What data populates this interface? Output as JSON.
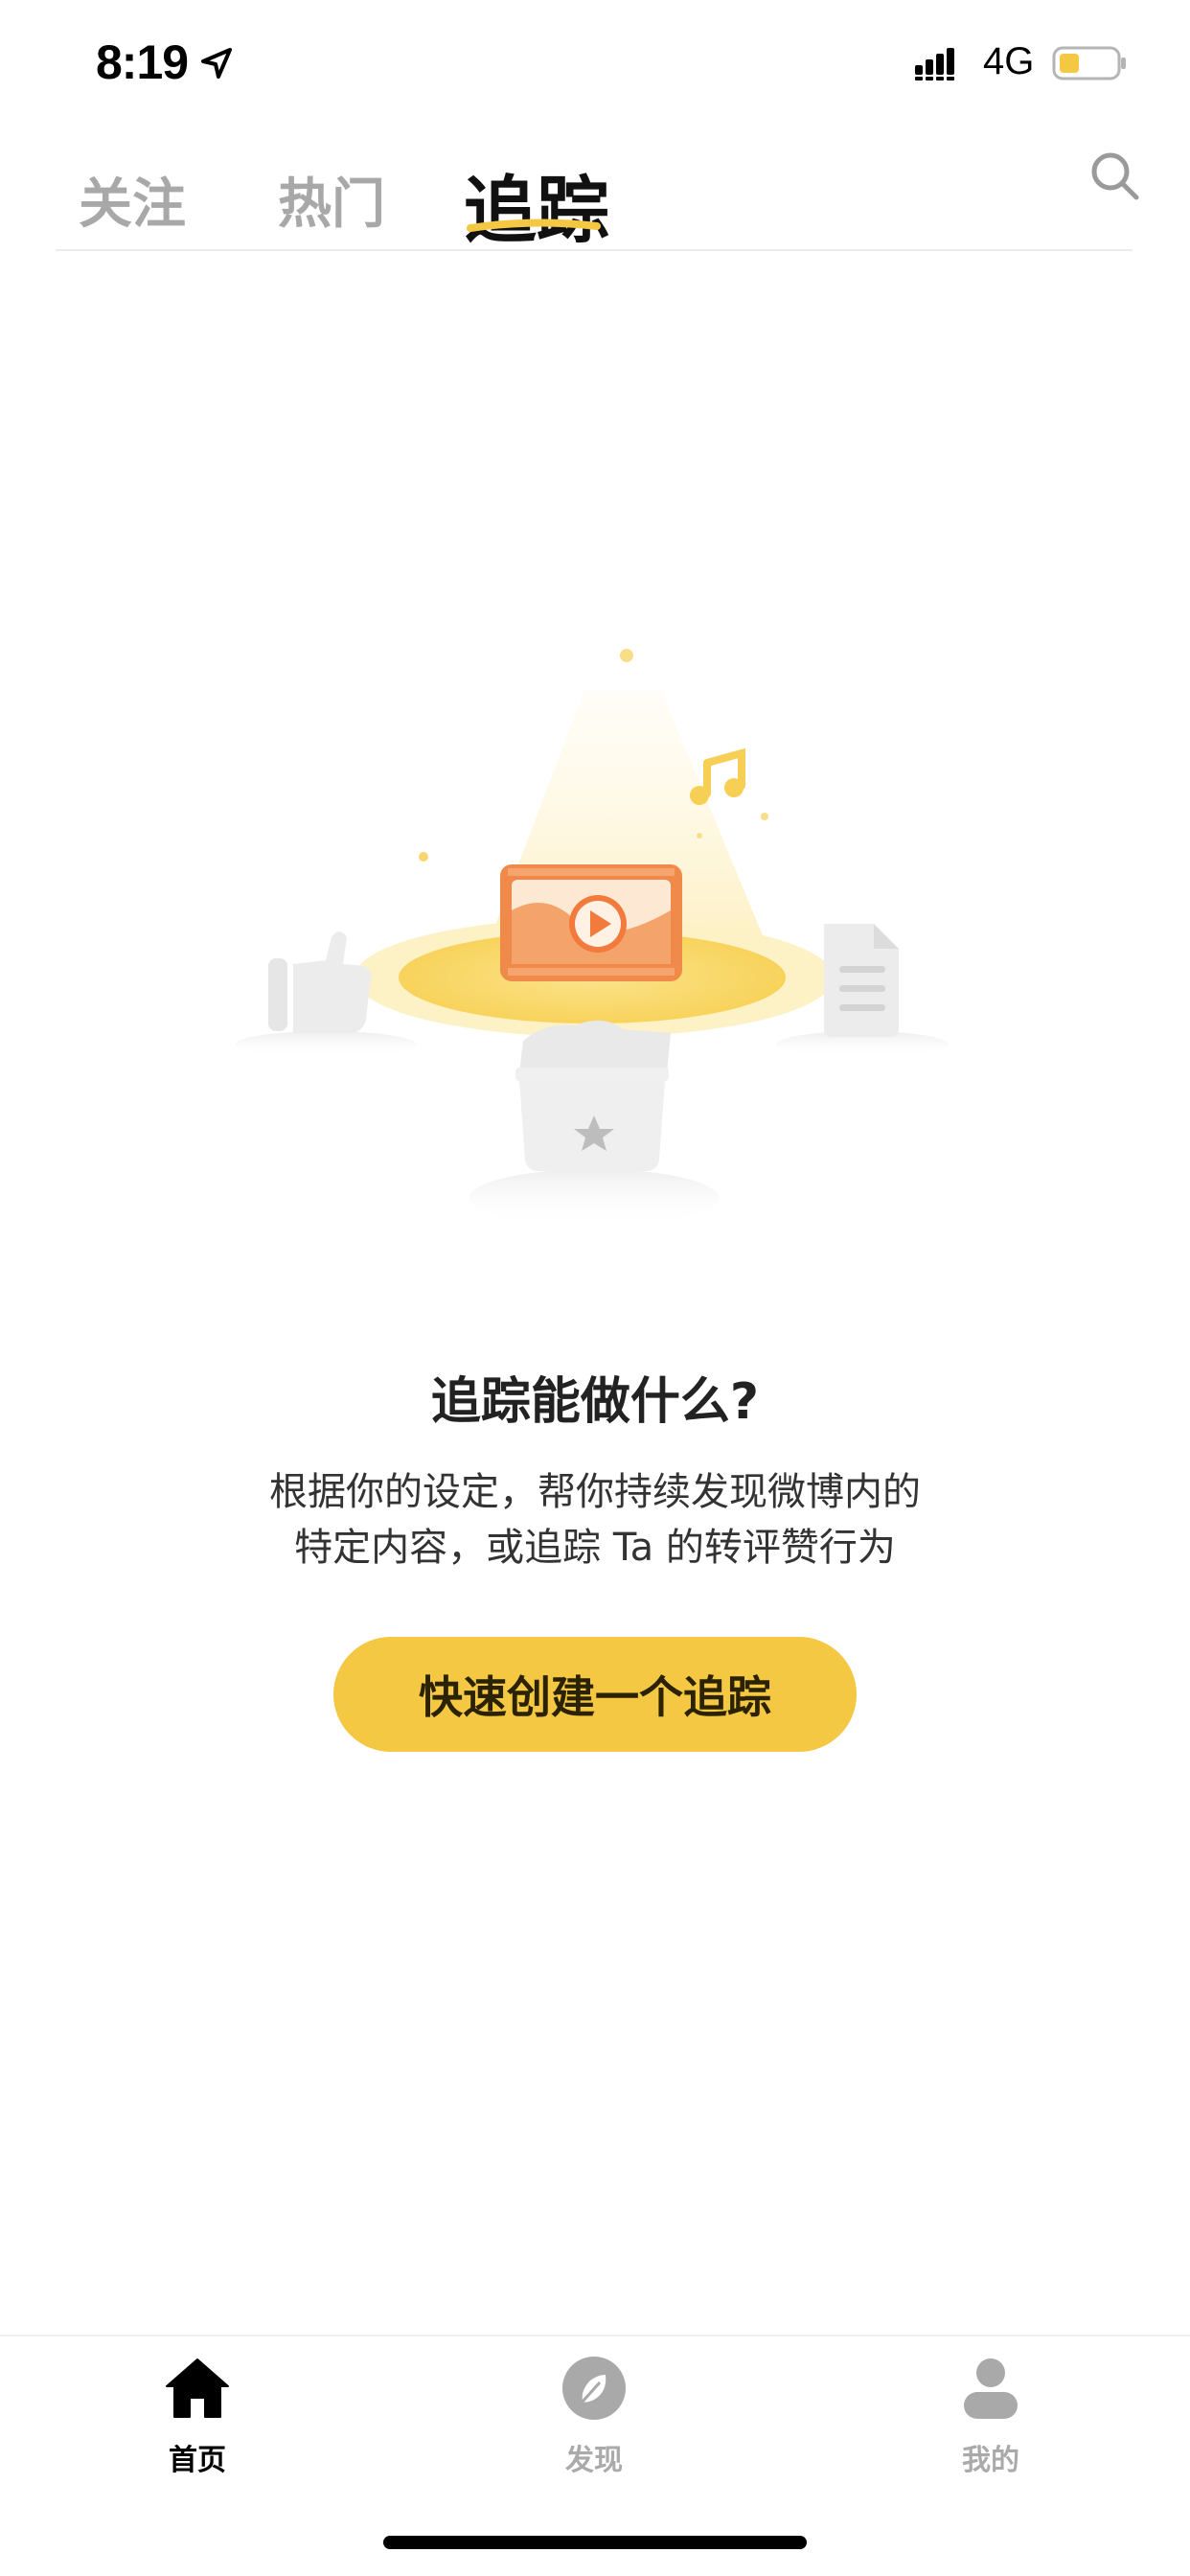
{
  "status_bar": {
    "time": "8:19",
    "network": "4G",
    "icons": [
      "location-arrow-icon",
      "signal-icon",
      "battery-icon"
    ],
    "battery_color": "#f5c843"
  },
  "header": {
    "tabs": [
      {
        "label": "关注",
        "active": false
      },
      {
        "label": "热门",
        "active": false
      },
      {
        "label": "追踪",
        "active": true
      }
    ],
    "search_icon": "search-icon",
    "accent_color": "#f5c843"
  },
  "empty_state": {
    "illustration": "tracking-illustration",
    "title": "追踪能做什么?",
    "description_line1": "根据你的设定，帮你持续发现微博内的",
    "description_line2": "特定内容，或追踪 Ta 的转评赞行为",
    "cta_label": "快速创建一个追踪"
  },
  "tab_bar": {
    "items": [
      {
        "label": "首页",
        "icon": "home-icon",
        "active": true
      },
      {
        "label": "发现",
        "icon": "compass-icon",
        "active": false
      },
      {
        "label": "我的",
        "icon": "person-icon",
        "active": false
      }
    ]
  }
}
